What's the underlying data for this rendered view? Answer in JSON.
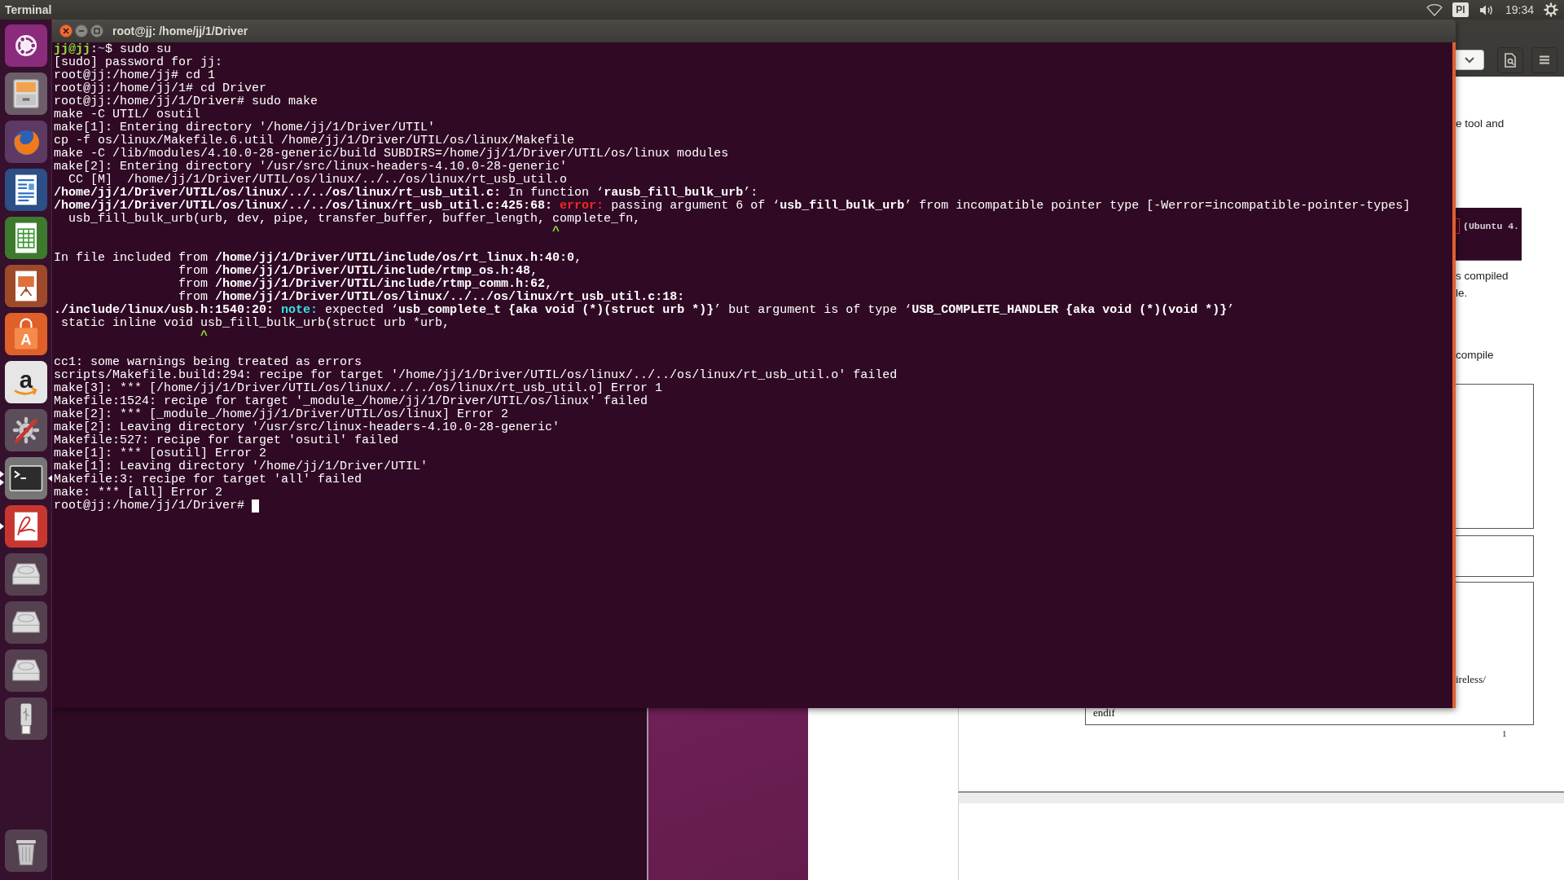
{
  "top_panel": {
    "app_name": "Terminal",
    "keyboard_layout": "Pl",
    "clock": "19:34"
  },
  "launcher": {
    "items": [
      {
        "kind": "dash",
        "running": false,
        "multiple_windows": false,
        "focused": false
      },
      {
        "kind": "files",
        "running": false,
        "multiple_windows": false,
        "focused": false
      },
      {
        "kind": "browser",
        "running": false,
        "multiple_windows": false,
        "focused": false
      },
      {
        "kind": "writer",
        "running": false,
        "multiple_windows": false,
        "focused": false
      },
      {
        "kind": "calc",
        "running": false,
        "multiple_windows": false,
        "focused": false
      },
      {
        "kind": "impress",
        "running": false,
        "multiple_windows": false,
        "focused": false
      },
      {
        "kind": "store",
        "glyph": "A",
        "running": false,
        "multiple_windows": false,
        "focused": false
      },
      {
        "kind": "shop",
        "glyph": "a",
        "running": false,
        "multiple_windows": false,
        "focused": false
      },
      {
        "kind": "settings",
        "running": false,
        "multiple_windows": false,
        "focused": false
      },
      {
        "kind": "terminal",
        "running": true,
        "multiple_windows": true,
        "focused": true
      },
      {
        "kind": "pdf",
        "running": true,
        "multiple_windows": false,
        "focused": false
      },
      {
        "kind": "disk",
        "running": false,
        "multiple_windows": false,
        "focused": false
      },
      {
        "kind": "disk",
        "running": false,
        "multiple_windows": false,
        "focused": false
      },
      {
        "kind": "disk",
        "running": false,
        "multiple_windows": false,
        "focused": false
      },
      {
        "kind": "usb",
        "running": false,
        "multiple_windows": false,
        "focused": false
      },
      {
        "kind": "trash",
        "running": false,
        "multiple_windows": false,
        "focused": false
      }
    ]
  },
  "terminal": {
    "title": "root@jj: /home/jj/1/Driver",
    "cursor_visible": true,
    "blocks": [
      {
        "lines": [
          {
            "segments": [
              {
                "kind": "user",
                "text": "jj@jj"
              },
              {
                "kind": "plain",
                "text": ":"
              },
              {
                "kind": "path",
                "text": "~"
              },
              {
                "kind": "plain",
                "text": "$ sudo su"
              }
            ]
          },
          {
            "segments": [
              {
                "kind": "plain",
                "text": "[sudo] password for jj:"
              }
            ]
          },
          {
            "segments": [
              {
                "kind": "plain",
                "text": "root@jj:/home/jj# cd 1"
              }
            ]
          },
          {
            "segments": [
              {
                "kind": "plain",
                "text": "root@jj:/home/jj/1# cd Driver"
              }
            ]
          },
          {
            "segments": [
              {
                "kind": "plain",
                "text": "root@jj:/home/jj/1/Driver# sudo make"
              }
            ]
          },
          {
            "segments": [
              {
                "kind": "plain",
                "text": "make -C UTIL/ osutil"
              }
            ]
          },
          {
            "segments": [
              {
                "kind": "plain",
                "text": "make[1]: Entering directory '/home/jj/1/Driver/UTIL'"
              }
            ]
          },
          {
            "segments": [
              {
                "kind": "plain",
                "text": "cp -f os/linux/Makefile.6.util /home/jj/1/Driver/UTIL/os/linux/Makefile"
              }
            ]
          },
          {
            "segments": [
              {
                "kind": "plain",
                "text": "make -C /lib/modules/4.10.0-28-generic/build SUBDIRS=/home/jj/1/Driver/UTIL/os/linux modules"
              }
            ]
          },
          {
            "segments": [
              {
                "kind": "plain",
                "text": "make[2]: Entering directory '/usr/src/linux-headers-4.10.0-28-generic'"
              }
            ]
          },
          {
            "segments": [
              {
                "kind": "plain",
                "text": "  CC [M]  /home/jj/1/Driver/UTIL/os/linux/../../os/linux/rt_usb_util.o"
              }
            ]
          },
          {
            "segments": [
              {
                "kind": "bold",
                "text": "/home/jj/1/Driver/UTIL/os/linux/../../os/linux/rt_usb_util.c:"
              },
              {
                "kind": "plain",
                "text": " In function ‘"
              },
              {
                "kind": "bold",
                "text": "rausb_fill_bulk_urb"
              },
              {
                "kind": "plain",
                "text": "’:"
              }
            ]
          },
          {
            "segments": [
              {
                "kind": "bold",
                "text": "/home/jj/1/Driver/UTIL/os/linux/../../os/linux/rt_usb_util.c:425:68: "
              },
              {
                "kind": "error",
                "text": "error:"
              },
              {
                "kind": "plain",
                "text": " passing argument 6 of ‘"
              },
              {
                "kind": "bold",
                "text": "usb_fill_bulk_urb"
              },
              {
                "kind": "plain",
                "text": "’ from incompatible pointer type [-Werror=incompatible-pointer-types]"
              }
            ]
          },
          {
            "segments": [
              {
                "kind": "plain",
                "text": "  usb_fill_bulk_urb(urb, dev, pipe, transfer_buffer, buffer_length, complete_fn,"
              }
            ]
          },
          {
            "segments": [
              {
                "kind": "caret",
                "text": "                                                                    ^"
              }
            ]
          }
        ]
      },
      {
        "lines": [
          {
            "segments": [
              {
                "kind": "plain",
                "text": "In file included from "
              },
              {
                "kind": "bold",
                "text": "/home/jj/1/Driver/UTIL/include/os/rt_linux.h:40:0"
              },
              {
                "kind": "plain",
                "text": ","
              }
            ]
          },
          {
            "segments": [
              {
                "kind": "plain",
                "text": "                 from "
              },
              {
                "kind": "bold",
                "text": "/home/jj/1/Driver/UTIL/include/rtmp_os.h:48"
              },
              {
                "kind": "plain",
                "text": ","
              }
            ]
          },
          {
            "segments": [
              {
                "kind": "plain",
                "text": "                 from "
              },
              {
                "kind": "bold",
                "text": "/home/jj/1/Driver/UTIL/include/rtmp_comm.h:62"
              },
              {
                "kind": "plain",
                "text": ","
              }
            ]
          },
          {
            "segments": [
              {
                "kind": "plain",
                "text": "                 from "
              },
              {
                "kind": "bold",
                "text": "/home/jj/1/Driver/UTIL/os/linux/../../os/linux/rt_usb_util.c:18:"
              }
            ]
          },
          {
            "segments": [
              {
                "kind": "bold",
                "text": "./include/linux/usb.h:1540:20: "
              },
              {
                "kind": "note",
                "text": "note:"
              },
              {
                "kind": "plain",
                "text": " expected ‘"
              },
              {
                "kind": "bold",
                "text": "usb_complete_t {aka void (*)(struct urb *)}"
              },
              {
                "kind": "plain",
                "text": "’ but argument is of type ‘"
              },
              {
                "kind": "bold",
                "text": "USB_COMPLETE_HANDLER {aka void (*)(void *)}"
              },
              {
                "kind": "plain",
                "text": "’"
              }
            ]
          },
          {
            "segments": [
              {
                "kind": "plain",
                "text": " static inline void usb_fill_bulk_urb(struct urb *urb,"
              }
            ]
          },
          {
            "segments": [
              {
                "kind": "caret",
                "text": "                    ^"
              }
            ]
          }
        ]
      },
      {
        "lines": [
          {
            "segments": [
              {
                "kind": "plain",
                "text": "cc1: some warnings being treated as errors"
              }
            ]
          },
          {
            "segments": [
              {
                "kind": "plain",
                "text": "scripts/Makefile.build:294: recipe for target '/home/jj/1/Driver/UTIL/os/linux/../../os/linux/rt_usb_util.o' failed"
              }
            ]
          },
          {
            "segments": [
              {
                "kind": "plain",
                "text": "make[3]: *** [/home/jj/1/Driver/UTIL/os/linux/../../os/linux/rt_usb_util.o] Error 1"
              }
            ]
          },
          {
            "segments": [
              {
                "kind": "plain",
                "text": "Makefile:1524: recipe for target '_module_/home/jj/1/Driver/UTIL/os/linux' failed"
              }
            ]
          },
          {
            "segments": [
              {
                "kind": "plain",
                "text": "make[2]: *** [_module_/home/jj/1/Driver/UTIL/os/linux] Error 2"
              }
            ]
          },
          {
            "segments": [
              {
                "kind": "plain",
                "text": "make[2]: Leaving directory '/usr/src/linux-headers-4.10.0-28-generic'"
              }
            ]
          },
          {
            "segments": [
              {
                "kind": "plain",
                "text": "Makefile:527: recipe for target 'osutil' failed"
              }
            ]
          },
          {
            "segments": [
              {
                "kind": "plain",
                "text": "make[1]: *** [osutil] Error 2"
              }
            ]
          },
          {
            "segments": [
              {
                "kind": "plain",
                "text": "make[1]: Leaving directory '/home/jj/1/Driver/UTIL'"
              }
            ]
          },
          {
            "segments": [
              {
                "kind": "plain",
                "text": "Makefile:3: recipe for target 'all' failed"
              }
            ]
          },
          {
            "segments": [
              {
                "kind": "plain",
                "text": "make: *** [all] Error 2"
              }
            ]
          },
          {
            "segments": [
              {
                "kind": "plain",
                "text": "root@jj:/home/jj/1/Driver#"
              }
            ]
          }
        ]
      }
    ]
  },
  "document_viewer": {
    "page": {
      "items": [
        {
          "kind": "paragraph",
          "lines": [
            "e tool and"
          ]
        },
        {
          "kind": "screenshot",
          "text": "(Ubuntu 4."
        },
        {
          "kind": "paragraph",
          "lines": [
            "s compiled",
            "le."
          ]
        },
        {
          "kind": "paragraph",
          "lines": [
            "compile"
          ]
        },
        {
          "kind": "code_box"
        },
        {
          "kind": "code_box"
        },
        {
          "kind": "code_box",
          "lines": [
            "ireless/",
            "endif"
          ]
        }
      ],
      "page_number": "1"
    }
  }
}
